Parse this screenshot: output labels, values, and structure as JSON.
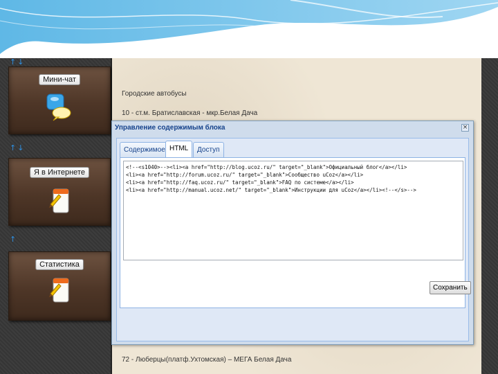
{
  "sidebar": {
    "blocks": [
      {
        "label": "Мини-чат",
        "icon": "chat-bubbles-icon"
      },
      {
        "label": "Я в Интернете",
        "icon": "notepad-pencil-icon"
      },
      {
        "label": "Статистика",
        "icon": "notepad-pencil-icon"
      }
    ],
    "arrow_glyphs": [
      "↑↓",
      "↑↓",
      "↑"
    ]
  },
  "content": {
    "heading": "Городские автобусы",
    "route_top": "10 - ст.м. Братиславская - мкр.Белая Дача",
    "route_bottom": "72 - Люберцы(платф.Ухтомская) – МЕГА Белая Дача"
  },
  "dialog": {
    "title": "Управление содержимым блока",
    "close_glyph": "×",
    "tabs": [
      {
        "label": "Содержимое",
        "active": false
      },
      {
        "label": "HTML",
        "active": true
      },
      {
        "label": "Доступ",
        "active": false
      }
    ],
    "code_lines": [
      "<!--<s1040>--><li><a href=\"http://blog.ucoz.ru/\" target=\"_blank\">Официальный блог</a></li>",
      "<li><a href=\"http://forum.ucoz.ru/\" target=\"_blank\">Сообщество uCoz</a></li>",
      "<li><a href=\"http://faq.ucoz.ru/\" target=\"_blank\">FAQ по системе</a></li>",
      "<li><a href=\"http://manual.ucoz.net/\" target=\"_blank\">Инструкции для uCoz</a></li><!--</s>-->"
    ],
    "save_label": "Сохранить"
  },
  "colors": {
    "accent_blue": "#2f8fe0",
    "dialog_title": "#15428b",
    "parchment": "#efe6d5"
  }
}
